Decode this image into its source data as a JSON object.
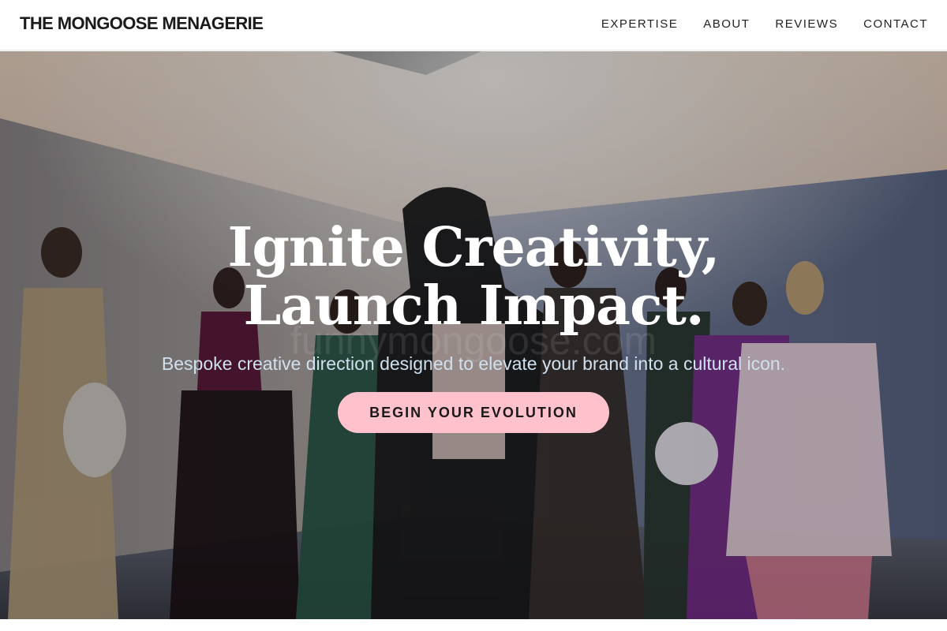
{
  "header": {
    "brand": "THE MONGOOSE MENAGERIE",
    "nav": [
      {
        "label": "EXPERTISE"
      },
      {
        "label": "ABOUT"
      },
      {
        "label": "REVIEWS"
      },
      {
        "label": "CONTACT"
      }
    ]
  },
  "hero": {
    "title": "Ignite Creativity, Launch Impact.",
    "subtitle": "Bespoke creative direction designed to elevate your brand into a cultural icon.",
    "cta_label": "BEGIN YOUR EVOLUTION",
    "watermark": "funnymongoose.com"
  },
  "colors": {
    "header_bg": "#ffffff",
    "brand_text": "#1a1a1a",
    "cta_bg": "#ffc1cc",
    "subtitle_text": "#cfe0ee",
    "title_text": "#ffffff"
  },
  "icons": [
    "hero-photo"
  ]
}
